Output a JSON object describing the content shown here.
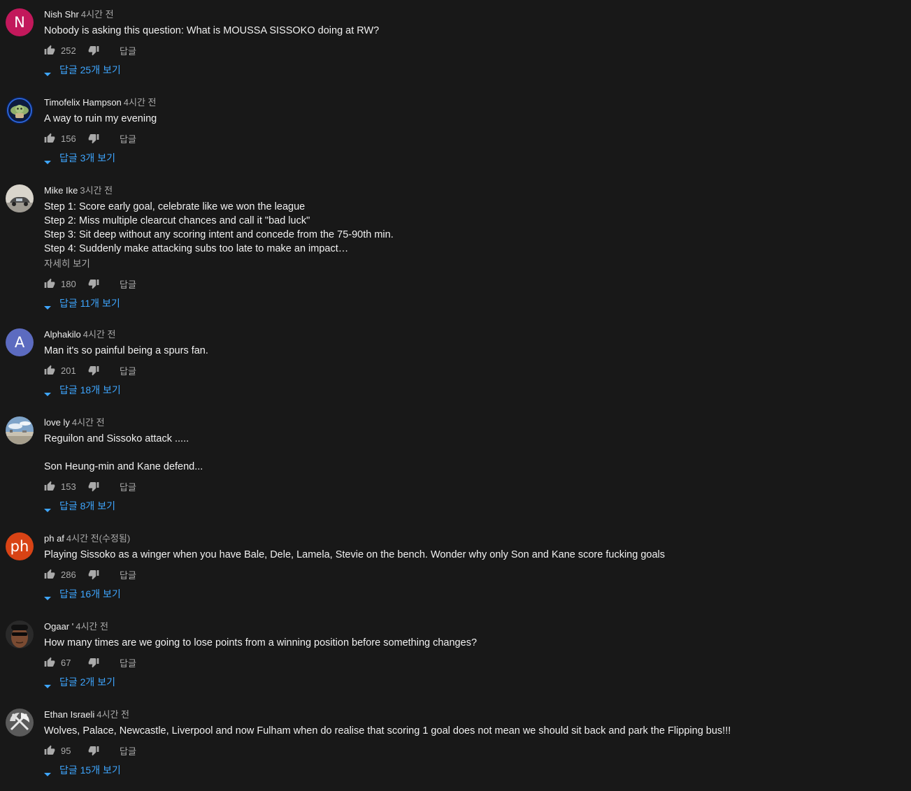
{
  "ui": {
    "reply_label": "답글",
    "link_color": "#3ea6ff",
    "meta_color": "#aaaaaa"
  },
  "comments": [
    {
      "author": "Nish Shr",
      "time": "4시간 전",
      "avatar": {
        "type": "letter",
        "letter": "N",
        "color": "#c2185b"
      },
      "text": "Nobody is asking this question: What is MOUSSA SISSOKO doing at RW?",
      "likes": "252",
      "replies": "답글 25개 보기"
    },
    {
      "author": "Timofelix Hampson",
      "time": "4시간 전",
      "avatar": {
        "type": "image",
        "icon": "yoda-avatar-icon"
      },
      "text": "A way to ruin my evening",
      "likes": "156",
      "replies": "답글 3개 보기"
    },
    {
      "author": "Mike Ike",
      "time": "3시간 전",
      "avatar": {
        "type": "image",
        "icon": "car-photo-avatar-icon"
      },
      "text": "Step 1:  Score early goal, celebrate like we won the league\nStep 2: Miss multiple clearcut chances and call it \"bad luck\"\nStep 3:  Sit deep without any scoring intent and concede from the 75-90th min.\nStep 4:  Suddenly make attacking subs too late to make an impact…",
      "more": "자세히 보기",
      "likes": "180",
      "replies": "답글 11개 보기"
    },
    {
      "author": "Alphakilo",
      "time": "4시간 전",
      "avatar": {
        "type": "letter",
        "letter": "A",
        "color": "#5c6bc0"
      },
      "text": "Man it's so painful being a spurs fan.",
      "likes": "201",
      "replies": "답글 18개 보기"
    },
    {
      "author": "love ly",
      "time": "4시간 전",
      "avatar": {
        "type": "image",
        "icon": "sky-photo-avatar-icon"
      },
      "text": "Reguilon and Sissoko attack .....\n\nSon Heung-min and Kane defend...",
      "likes": "153",
      "replies": "답글 8개 보기"
    },
    {
      "author": "ph af",
      "time": "4시간 전(수정됨)",
      "avatar": {
        "type": "letter",
        "letter": "ph",
        "color": "#d84315"
      },
      "text": "Playing Sissoko as a winger when you have Bale, Dele, Lamela, Stevie on the bench. Wonder why only Son and Kane score fucking goals",
      "likes": "286",
      "replies": "답글 16개 보기"
    },
    {
      "author": "Ogaar '",
      "time": "4시간 전",
      "avatar": {
        "type": "image",
        "icon": "sunglasses-face-avatar-icon"
      },
      "text": "How many times are we going to lose points from a winning position before something changes?",
      "likes": "67",
      "replies": "답글 2개 보기"
    },
    {
      "author": "Ethan Israeli",
      "time": "4시간 전",
      "avatar": {
        "type": "image",
        "icon": "axe-avatar-icon"
      },
      "text": "Wolves, Palace, Newcastle, Liverpool and now Fulham when do realise that scoring 1 goal does not mean we should sit back and park the Flipping bus!!!",
      "likes": "95",
      "replies": "답글 15개 보기"
    }
  ]
}
